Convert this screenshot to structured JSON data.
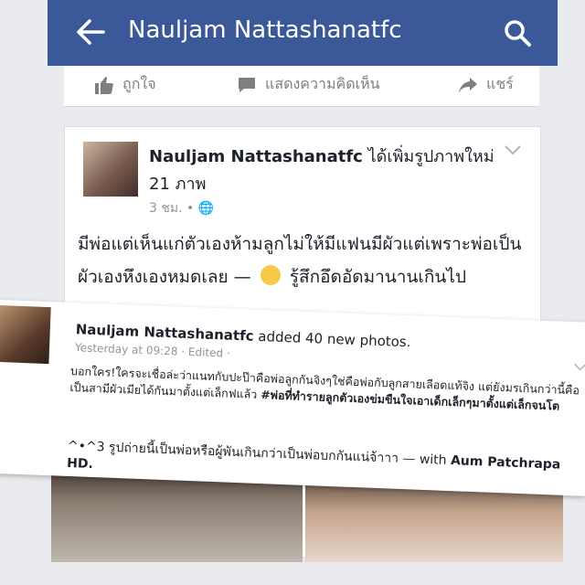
{
  "topbar": {
    "title": "Nauljam Nattashanatfc",
    "bg_color": "#3b5998",
    "back_icon": "arrow-left-icon",
    "search_icon": "search-icon"
  },
  "actions": {
    "like": "ถูกใจ",
    "comment": "แสดงความคิดเห็น",
    "share": "แชร์"
  },
  "post": {
    "author": "Nauljam Nattashanatfc",
    "added_text": "ได้เพิ่มรูปภาพใหม่ 21 ภาพ",
    "time": "3 ชม. •",
    "text_main": "มีพ่อแต่เห็นแก่ตัวเองห้ามลูกไม่ให้มีแฟนมีผัวแต่เพราะพ่อเป็นผัวเองหึงเองหมดเลย —",
    "feeling": "รู้สึกอึดอัดมานานเกินไป"
  },
  "overlay_post": {
    "author": "Nauljam Nattashanatfc",
    "added_text": "added 40 new photos.",
    "meta": "Yesterday at 09:28 · Edited ·",
    "text_part1": "บอกใคร!ใครจะเชื่อล่ะว่าแนทกับปะป๊าคือพ่อลูกกันจิงๆใช่คือพ่อกับลูกสายเลือดแท้จิง แต่ยังมรเกินกว่านี้คือเป็นสามีผัวเมียได้กันมาตั้งแต่เล็กฟแล้ว",
    "hashtag": "#พ่อที่ทำรายลูกตัวเองข่มขืนใจเอาเด็กเล็กๆมาตั้งแต่เล็กจนโต",
    "text_line2_pre": "^•^3 รูปถ่ายนี้เป็นพ่อหรือผู้พันเกินกว่าเป็นพ่อบกกันแน่จ้าาา — with",
    "tagged": "Aum Patchrapa",
    "hd": "HD."
  }
}
